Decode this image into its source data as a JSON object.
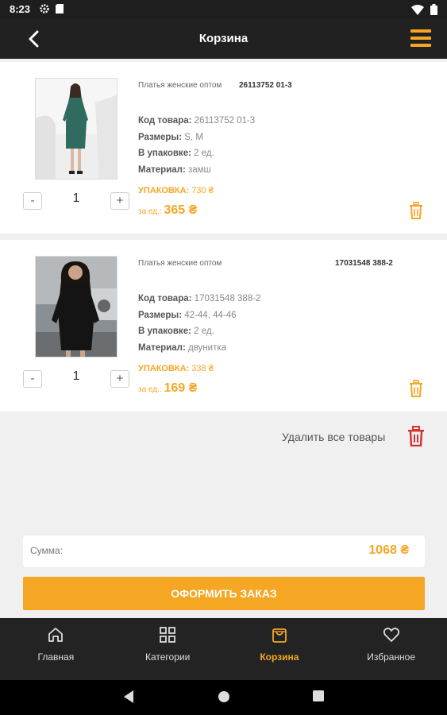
{
  "status_bar": {
    "time": "8:23",
    "icons_left": [
      "gear-icon",
      "sd-card-icon"
    ],
    "icons_right": [
      "wifi-icon",
      "battery-icon"
    ]
  },
  "app_bar": {
    "title": "Корзина",
    "back_icon": "arrow-left-icon",
    "menu_icon": "hamburger-menu-icon"
  },
  "cart": {
    "items": [
      {
        "name": "Платья женские оптом",
        "sku_header": "26113752   01-3",
        "code_label": "Код товара:",
        "code_value": "26113752    01-3",
        "sizes_label": "Размеры:",
        "sizes_value": "S, M",
        "pack_label": "В упаковке:",
        "pack_value": "2 ед.",
        "material_label": "Материал:",
        "material_value": "замш",
        "package_label": "УПАКОВКА:",
        "package_price": "730 ₴",
        "unit_label": "за ед.:",
        "unit_price": "365 ₴",
        "quantity": "1",
        "minus": "-",
        "plus": "+"
      },
      {
        "name": "Платья женские оптом",
        "sku_header": "17031548  388-2",
        "code_label": "Код товара:",
        "code_value": "17031548   388-2",
        "sizes_label": "Размеры:",
        "sizes_value": "42-44, 44-46",
        "pack_label": "В упаковке:",
        "pack_value": "2 ед.",
        "material_label": "Материал:",
        "material_value": "двунитка",
        "package_label": "УПАКОВКА:",
        "package_price": "338 ₴",
        "unit_label": "за ед.:",
        "unit_price": "169 ₴",
        "quantity": "1",
        "minus": "-",
        "plus": "+"
      }
    ],
    "delete_all_label": "Удалить все товары",
    "sum_label": "Сумма:",
    "sum_value": "1068 ₴",
    "checkout_label": "ОФОРМИТЬ ЗАКАЗ"
  },
  "bottom_nav": {
    "items": [
      {
        "label": "Главная",
        "icon": "home-icon",
        "active": false
      },
      {
        "label": "Категории",
        "icon": "grid-icon",
        "active": false
      },
      {
        "label": "Корзина",
        "icon": "bag-icon",
        "active": true
      },
      {
        "label": "Избранное",
        "icon": "heart-icon",
        "active": false
      }
    ]
  },
  "colors": {
    "accent": "#f5a623",
    "app_bar": "#212121",
    "delete_icon": "#d0342c"
  }
}
